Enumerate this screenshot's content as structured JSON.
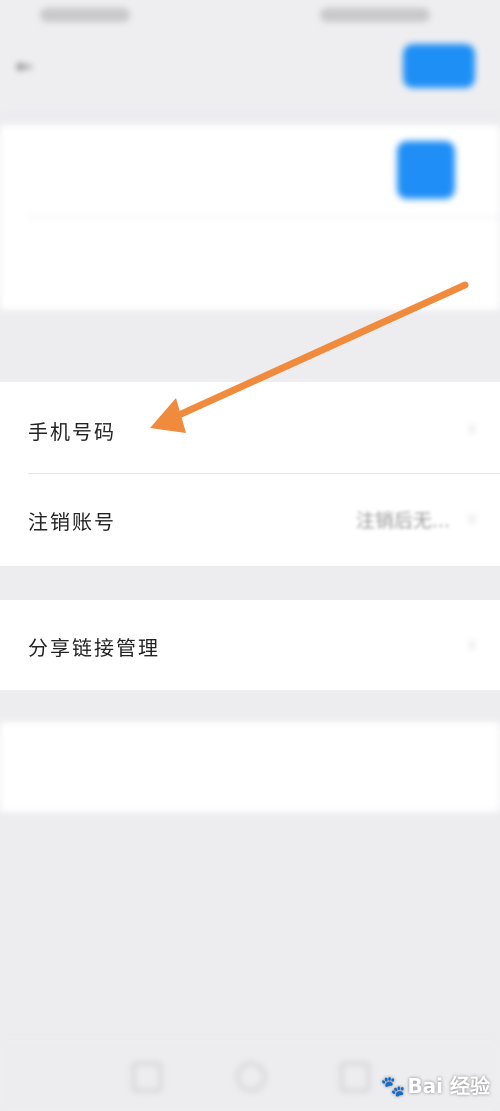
{
  "header": {
    "back_label": "←",
    "title": "",
    "save_label": ""
  },
  "profile_rows": [
    {
      "label": "",
      "avatar_text": ""
    },
    {
      "label": "",
      "value": ""
    }
  ],
  "hint_text": "",
  "phone": {
    "label": "手机号码",
    "value": "",
    "chevron": "›"
  },
  "deactivate": {
    "label": "注销账号",
    "value": "注销后无...",
    "chevron": "›"
  },
  "share": {
    "label": "分享链接管理",
    "chevron": "›"
  },
  "logout_label": "",
  "watermark": {
    "text": "Bai 经验",
    "icon": "paw-icon"
  },
  "colors": {
    "accent_blue": "#1e8ff5",
    "arrow_orange": "#f08a3c",
    "danger_red": "#e0404a",
    "background": "#ededf0"
  },
  "annotation": {
    "icon": "arrow-icon",
    "points_to": "手机号码"
  }
}
